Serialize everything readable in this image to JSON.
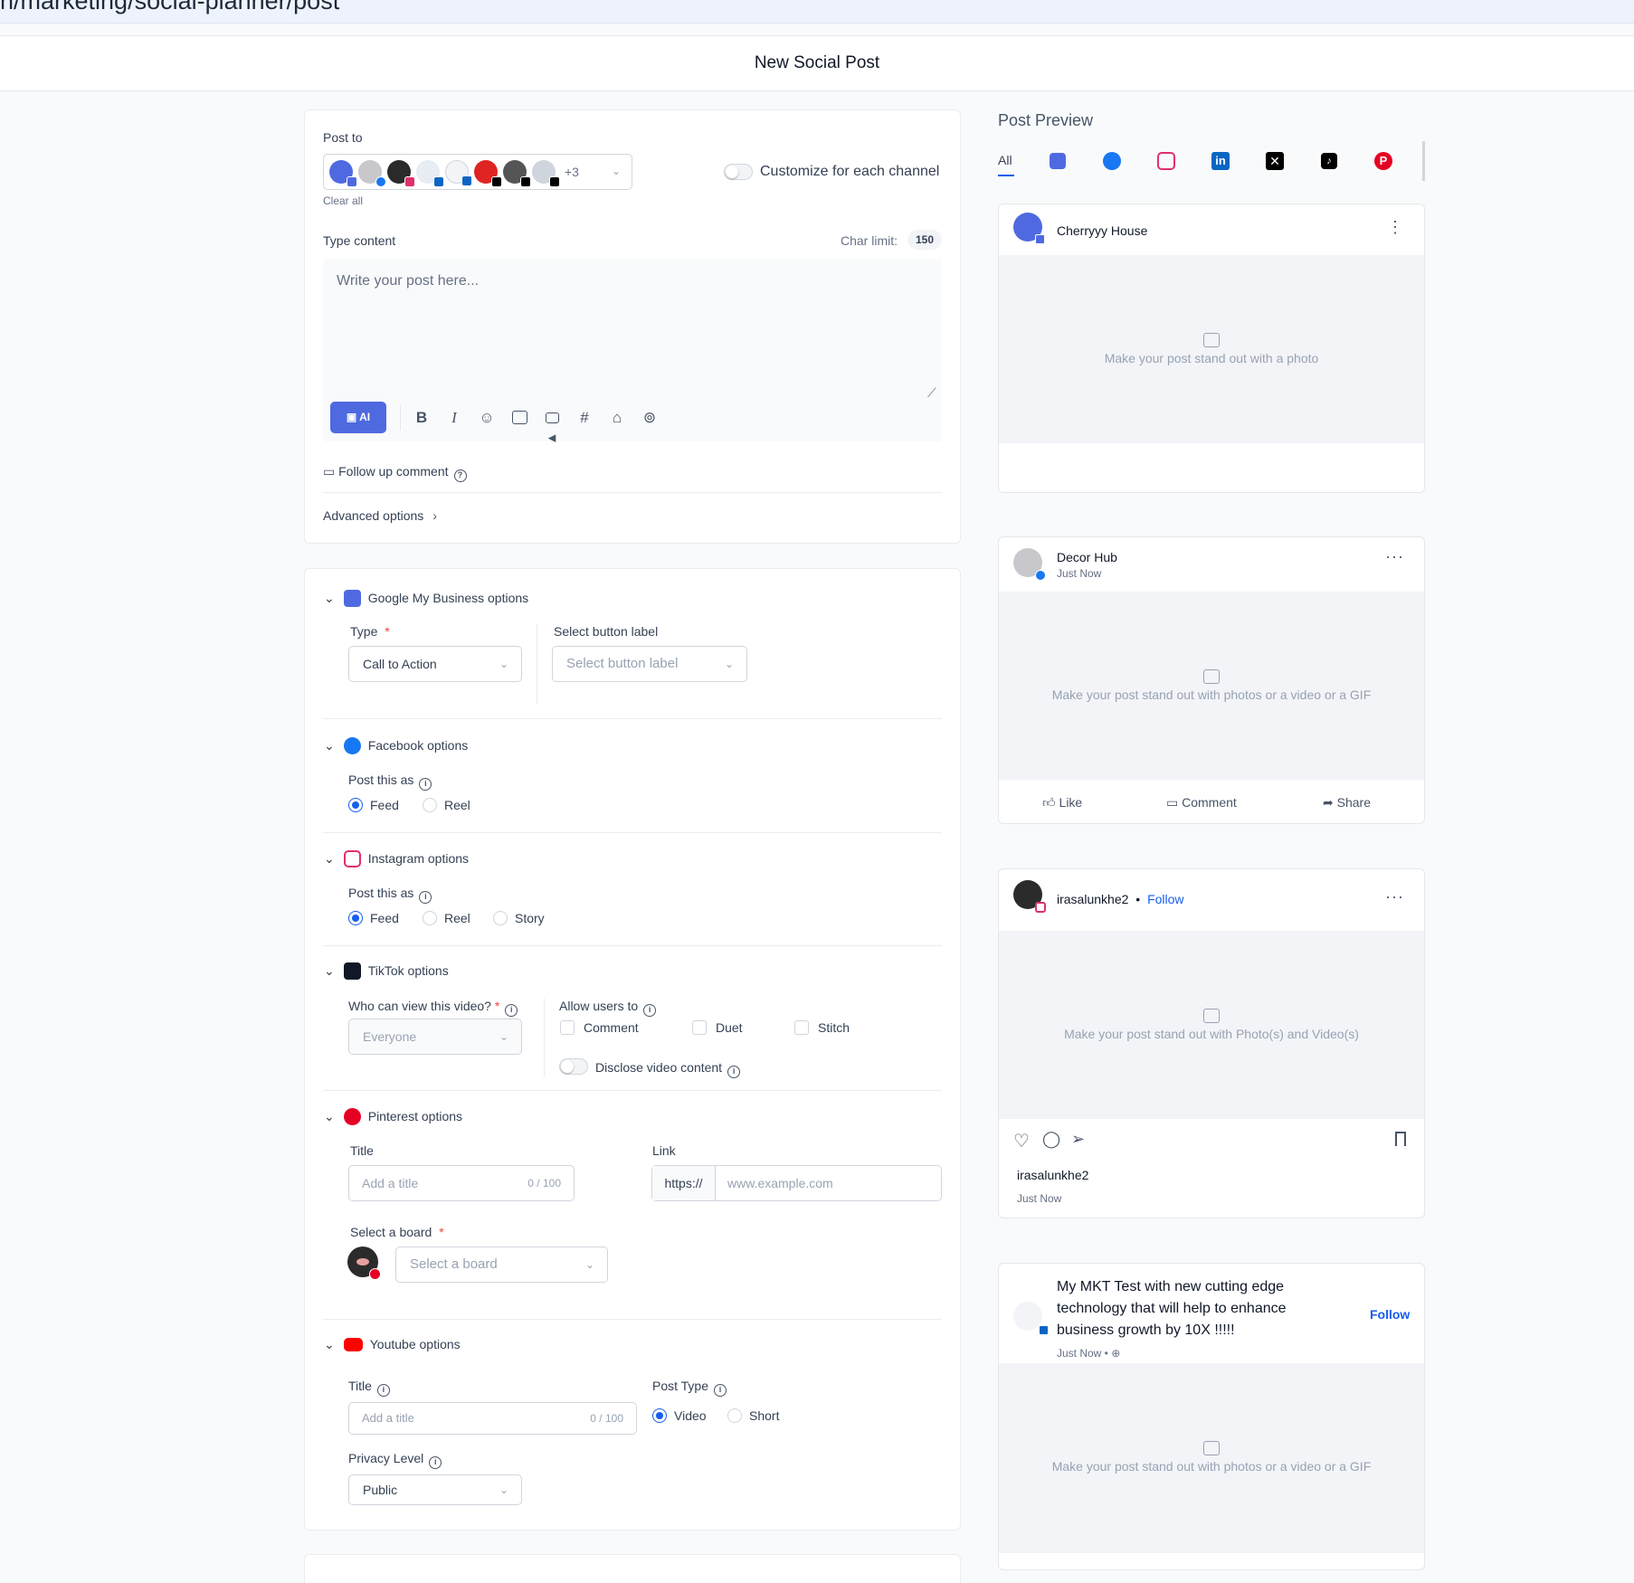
{
  "url": "n/marketing/social-planner/post",
  "page_title": "New Social Post",
  "compose": {
    "post_to_label": "Post to",
    "accounts_more": "+3",
    "clear_all": "Clear all",
    "customize_label": "Customize for each channel",
    "type_content_label": "Type content",
    "char_limit_label": "Char limit:",
    "char_limit_value": "150",
    "content_placeholder": "Write your post here...",
    "ai_button": "AI",
    "follow_up": "Follow up comment",
    "advanced": "Advanced options"
  },
  "gmb": {
    "heading": "Google My Business options",
    "type_label": "Type",
    "type_value": "Call to Action",
    "button_label": "Select button label",
    "button_placeholder": "Select button label"
  },
  "facebook": {
    "heading": "Facebook options",
    "post_as_label": "Post this as",
    "feed": "Feed",
    "reel": "Reel"
  },
  "instagram": {
    "heading": "Instagram options",
    "post_as_label": "Post this as",
    "feed": "Feed",
    "reel": "Reel",
    "story": "Story"
  },
  "tiktok": {
    "heading": "TikTok options",
    "who_label": "Who can view this video?",
    "who_value": "Everyone",
    "allow_label": "Allow users to",
    "comment": "Comment",
    "duet": "Duet",
    "stitch": "Stitch",
    "disclose": "Disclose video content"
  },
  "pinterest": {
    "heading": "Pinterest options",
    "title_label": "Title",
    "title_placeholder": "Add a title",
    "title_count": "0 / 100",
    "link_label": "Link",
    "link_prefix": "https://",
    "link_placeholder": "www.example.com",
    "board_label": "Select a board",
    "board_placeholder": "Select a board"
  },
  "youtube": {
    "heading": "Youtube options",
    "title_label": "Title",
    "title_placeholder": "Add a title",
    "title_count": "0 / 100",
    "post_type_label": "Post Type",
    "video": "Video",
    "short": "Short",
    "privacy_label": "Privacy Level",
    "privacy_value": "Public"
  },
  "preview": {
    "heading": "Post Preview",
    "tab_all": "All",
    "gmb_name": "Cherryyy House",
    "gmb_caption": "Make your post stand out with a photo",
    "fb_name": "Decor Hub",
    "fb_time": "Just Now",
    "fb_caption": "Make your post stand out with photos or a video or a GIF",
    "fb_like": "Like",
    "fb_comment": "Comment",
    "fb_share": "Share",
    "ig_name": "irasalunkhe2",
    "ig_sep": "•",
    "ig_follow": "Follow",
    "ig_caption": "Make your post stand out with Photo(s) and Video(s)",
    "ig_user": "irasalunkhe2",
    "ig_time": "Just Now",
    "li_name_1": "My MKT Test with new cutting edge",
    "li_name_2": "technology that will help to enhance",
    "li_name_3": "business growth by 10X !!!!!",
    "li_time": "Just Now • ⊕",
    "li_follow": "Follow",
    "li_caption": "Make your post stand out with photos or a video or a GIF"
  },
  "colors": {
    "primary": "#155eef",
    "ai": "#4f6ae0",
    "facebook": "#1877f2",
    "instagram": "#e1306c",
    "linkedin": "#0a66c2",
    "pinterest": "#e60023",
    "youtube": "#ff0000",
    "required": "#f04438"
  }
}
